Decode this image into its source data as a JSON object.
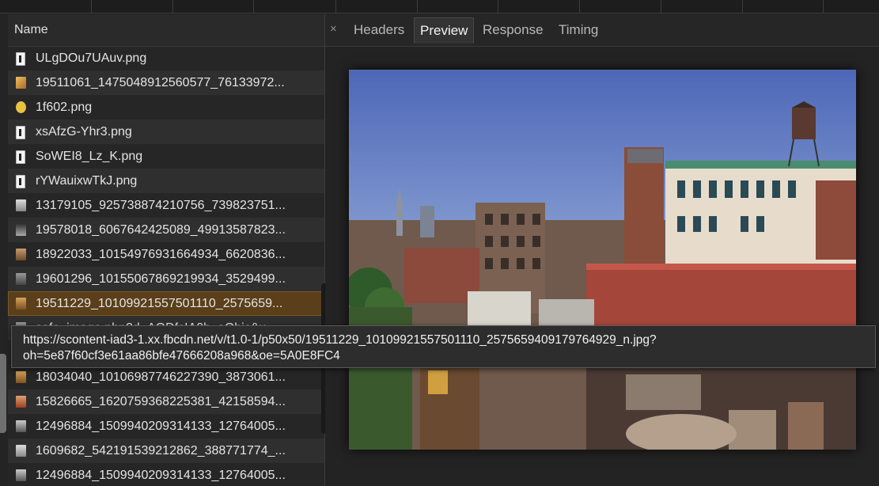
{
  "network_list": {
    "header": "Name",
    "rows": [
      {
        "name": "ULgDOu7UAuv.png",
        "icon": "document-icon"
      },
      {
        "name": "19511061_1475048912560577_76133972...",
        "icon": "image-thumbnail-icon"
      },
      {
        "name": "1f602.png",
        "icon": "emoji-icon"
      },
      {
        "name": "xsAfzG-Yhr3.png",
        "icon": "document-icon"
      },
      {
        "name": "SoWEI8_Lz_K.png",
        "icon": "document-icon"
      },
      {
        "name": "rYWauixwTkJ.png",
        "icon": "document-icon"
      },
      {
        "name": "13179105_925738874210756_739823751...",
        "icon": "image-thumbnail-icon"
      },
      {
        "name": "19578018_6067642425089_49913587823...",
        "icon": "image-thumbnail-icon"
      },
      {
        "name": "18922033_10154976931664934_6620836...",
        "icon": "image-thumbnail-icon"
      },
      {
        "name": "19601296_10155067869219934_3529499...",
        "icon": "image-thumbnail-icon"
      },
      {
        "name": "19511229_10109921557501110_2575659...",
        "icon": "image-thumbnail-icon",
        "selected": true
      },
      {
        "name": "safe_image.php?d=AQDfcIA0b_aObic&u...",
        "icon": "image-thumbnail-icon"
      },
      {
        "name": "18034040_10106987746227390_3873061...",
        "icon": "image-thumbnail-icon"
      },
      {
        "name": "15826665_1620759368225381_42158594...",
        "icon": "image-thumbnail-icon"
      },
      {
        "name": "12496884_1509940209314133_12764005...",
        "icon": "image-thumbnail-icon"
      },
      {
        "name": "1609682_542191539212862_388771774_...",
        "icon": "image-thumbnail-icon"
      },
      {
        "name": "12496884_1509940209314133_12764005...",
        "icon": "image-thumbnail-icon"
      }
    ]
  },
  "detail_tabs": {
    "close_glyph": "×",
    "tabs": [
      "Headers",
      "Preview",
      "Response",
      "Timing"
    ],
    "active": "Preview"
  },
  "tooltip": {
    "line1": "https://scontent-iad3-1.xx.fbcdn.net/v/t1.0-1/p50x50/19511229_10109921557501110_2575659409179764929_n.jpg?",
    "line2": "oh=5e87f60cf3e61aa86bfe47666208a968&oe=5A0E8FC4"
  }
}
